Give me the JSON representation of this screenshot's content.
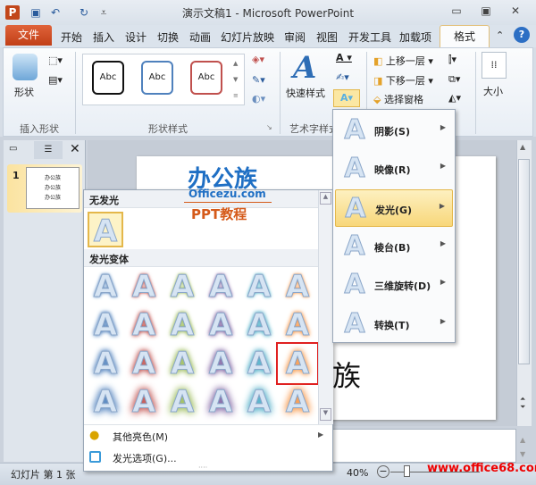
{
  "window": {
    "title": "演示文稿1 - Microsoft PowerPoint"
  },
  "quick_access": [
    "powerpoint-logo",
    "save-icon",
    "undo-icon",
    "redo-icon",
    "customize-icon"
  ],
  "tabs": {
    "file": "文件",
    "items": [
      "开始",
      "插入",
      "设计",
      "切换",
      "动画",
      "幻灯片放映",
      "审阅",
      "视图",
      "开发工具",
      "加载项"
    ],
    "active": "格式"
  },
  "ribbon": {
    "insert_shapes": {
      "label": "插入形状",
      "shapes_button": "形状"
    },
    "shape_styles": {
      "label": "形状样式",
      "styles": [
        "Abc",
        "Abc",
        "Abc"
      ]
    },
    "wordart": {
      "label": "艺术字样式",
      "quick_styles": "快速样式"
    },
    "arrange": {
      "bring_forward": "上移一层",
      "send_backward": "下移一层",
      "selection_pane": "选择窗格"
    },
    "size": {
      "label": "大小"
    }
  },
  "slide": {
    "logo_text": "办公族",
    "logo_sub": "Officezu.com",
    "logo_tag": "PPT教程",
    "partial_text": "族",
    "thumb_lines": [
      "办公族",
      "办公族",
      "办公族"
    ],
    "number": "1"
  },
  "gallery": {
    "no_glow": "无发光",
    "variants": "发光变体",
    "glyph": "A",
    "colors": [
      "#4f81bd",
      "#c0504d",
      "#9bbb59",
      "#8064a2",
      "#4bacc6",
      "#f79646"
    ],
    "more_colors": "其他亮色(M)",
    "glow_options": "发光选项(G)..."
  },
  "submenu": [
    {
      "label": "阴影(S)"
    },
    {
      "label": "映像(R)"
    },
    {
      "label": "发光(G)",
      "active": true
    },
    {
      "label": "棱台(B)"
    },
    {
      "label": "三维旋转(D)"
    },
    {
      "label": "转换(T)"
    }
  ],
  "status": {
    "slide_info": "幻灯片 第 1 张",
    "zoom": "40%",
    "watermark": "www.office68.com"
  }
}
